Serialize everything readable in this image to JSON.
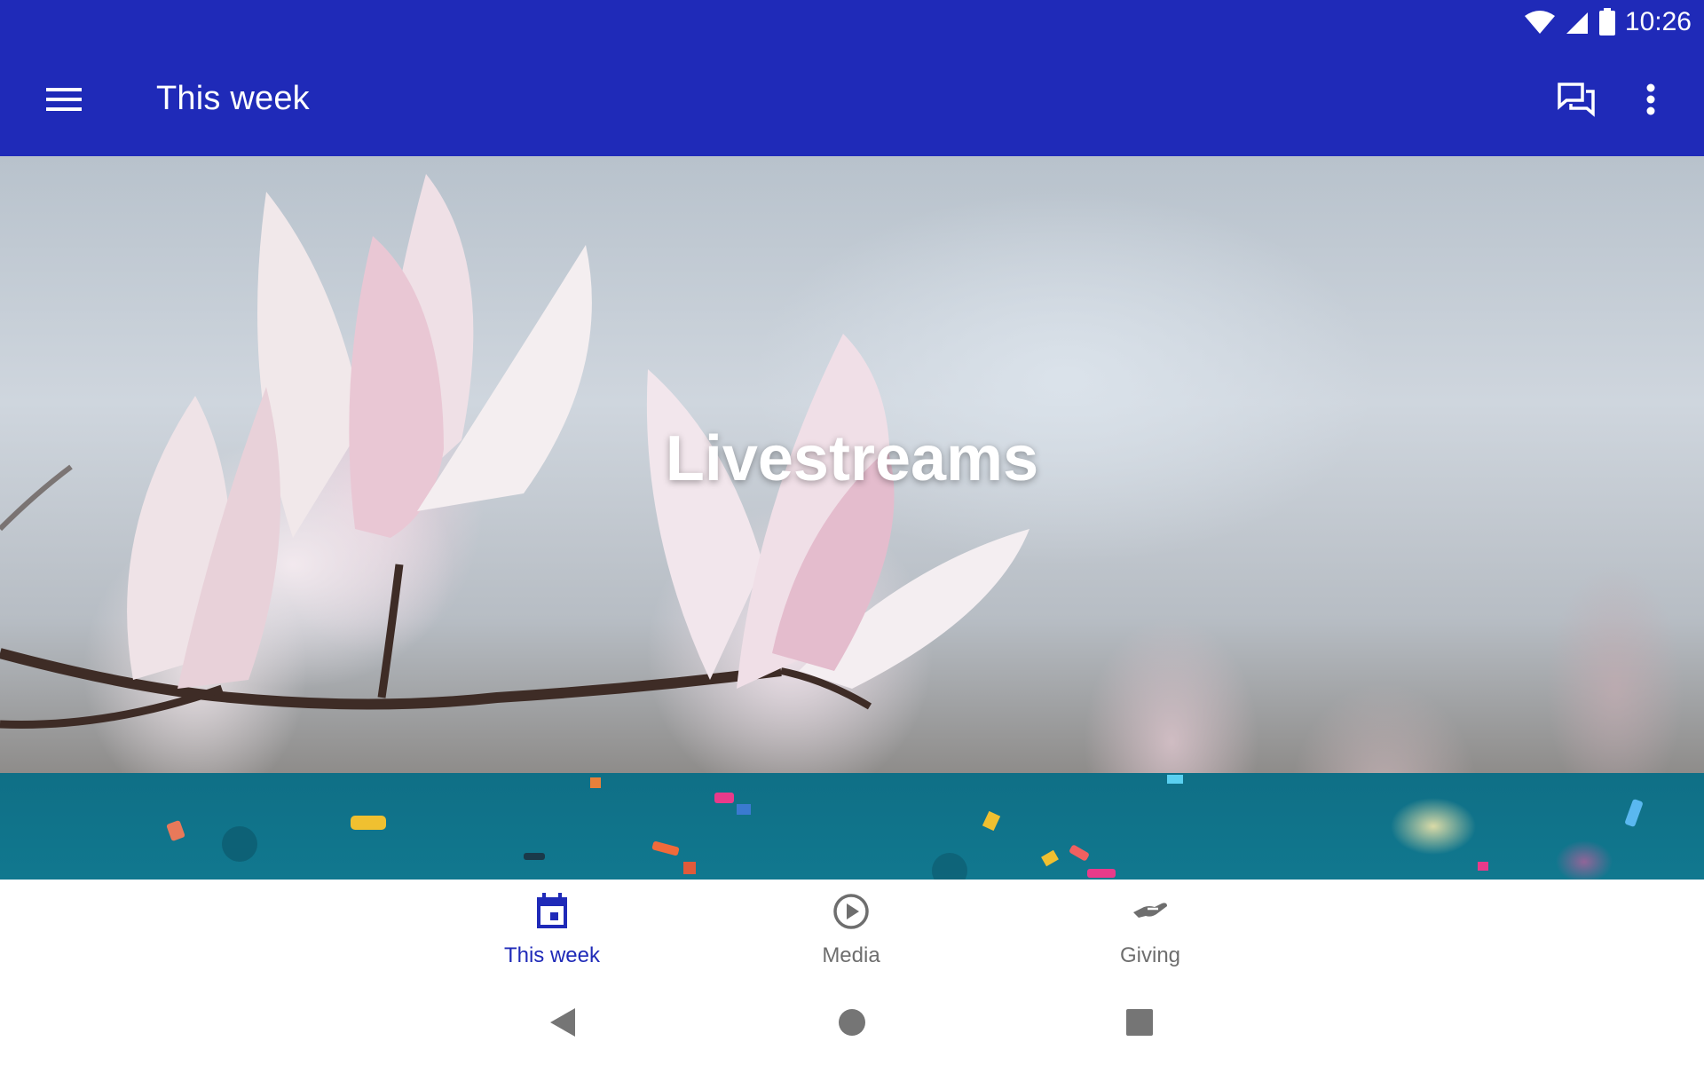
{
  "status_bar": {
    "time": "10:26",
    "icons": [
      "wifi-icon",
      "cell-signal-icon",
      "battery-icon"
    ]
  },
  "app_bar": {
    "title": "This week",
    "left_icon": "menu-icon",
    "right_icons": [
      "chat-icon",
      "more-vert-icon"
    ]
  },
  "content": {
    "cards": [
      {
        "title": "Livestreams"
      },
      {
        "title": ""
      }
    ]
  },
  "bottom_nav": {
    "items": [
      {
        "label": "This week",
        "icon": "calendar-icon",
        "active": true
      },
      {
        "label": "Media",
        "icon": "play-circle-icon",
        "active": false
      },
      {
        "label": "Giving",
        "icon": "giving-hand-icon",
        "active": false
      }
    ]
  },
  "system_nav": {
    "buttons": [
      "back-icon",
      "home-icon",
      "recents-icon"
    ]
  },
  "colors": {
    "primary": "#1f2ab8",
    "inactive": "#6e6e6e",
    "card_teal": "#0f6f86"
  }
}
